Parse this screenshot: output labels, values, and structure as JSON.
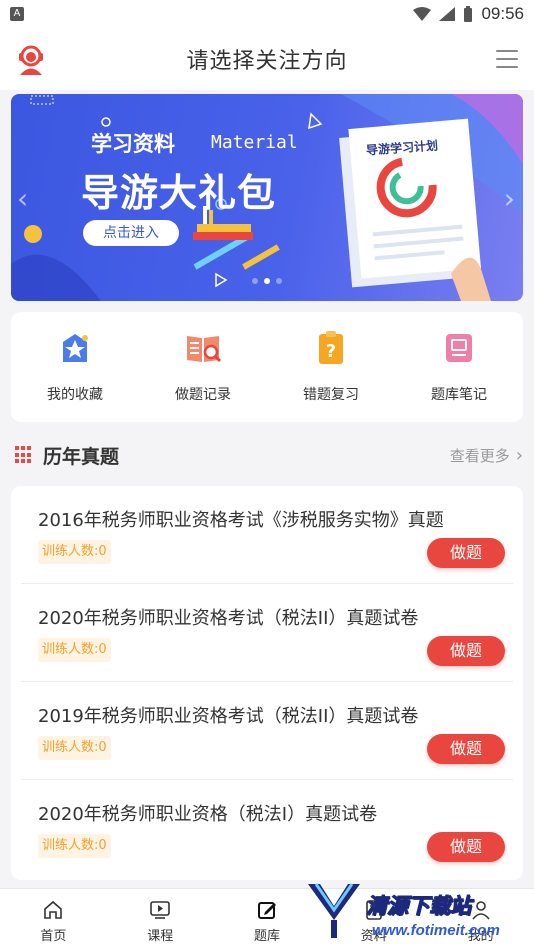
{
  "status_bar": {
    "time": "09:56",
    "sim_badge": "A"
  },
  "header": {
    "title": "请选择关注方向"
  },
  "banner": {
    "line1": "学习资料",
    "material": "Material",
    "big_text": "导游大礼包",
    "button": "点击进入",
    "paper_title": "导游学习计划"
  },
  "quick_actions": [
    {
      "label": "我的收藏",
      "icon": "star-box-icon"
    },
    {
      "label": "做题记录",
      "icon": "book-search-icon"
    },
    {
      "label": "错题复习",
      "icon": "question-clipboard-icon"
    },
    {
      "label": "题库笔记",
      "icon": "note-icon"
    }
  ],
  "section": {
    "title": "历年真题",
    "more": "查看更多"
  },
  "exams": [
    {
      "title": "2016年税务师职业资格考试《涉税服务实物》真题",
      "count": "训练人数:0",
      "button": "做题"
    },
    {
      "title": "2020年税务师职业资格考试（税法II）真题试卷",
      "count": "训练人数:0",
      "button": "做题"
    },
    {
      "title": "2019年税务师职业资格考试（税法II）真题试卷",
      "count": "训练人数:0",
      "button": "做题"
    },
    {
      "title": "2020年税务师职业资格（税法I）真题试卷",
      "count": "训练人数:0",
      "button": "做题"
    }
  ],
  "bottom_nav": [
    {
      "label": "首页",
      "icon": "home-icon"
    },
    {
      "label": "课程",
      "icon": "video-icon"
    },
    {
      "label": "题库",
      "icon": "edit-icon"
    },
    {
      "label": "资料",
      "icon": "document-icon"
    },
    {
      "label": "我的",
      "icon": "user-icon"
    }
  ],
  "watermark": {
    "title": "清源下载站",
    "url": "www.fotimeit.com"
  },
  "colors": {
    "accent": "#e8463f",
    "banner": "#3b57e0",
    "count_text": "#f4a12c"
  }
}
